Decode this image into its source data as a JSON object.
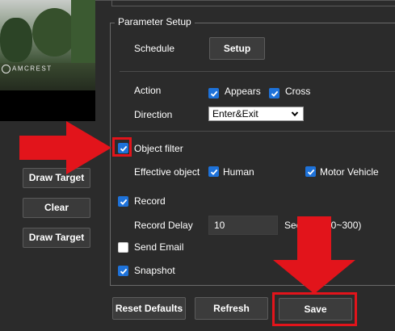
{
  "preview": {
    "logo_text": "AMCREST"
  },
  "left_buttons": [
    "Draw Target",
    "Clear",
    "Draw Target"
  ],
  "parameter_setup": {
    "legend": "Parameter Setup",
    "schedule": {
      "label": "Schedule",
      "button": "Setup"
    },
    "action": {
      "label": "Action",
      "appears": {
        "label": "Appears",
        "checked": true
      },
      "cross": {
        "label": "Cross",
        "checked": true
      }
    },
    "direction": {
      "label": "Direction",
      "value": "Enter&Exit"
    },
    "object_filter": {
      "label": "Object filter",
      "checked": true
    },
    "effective_object": {
      "label": "Effective object",
      "human": {
        "label": "Human",
        "checked": true
      },
      "motor_vehicle": {
        "label": "Motor Vehicle",
        "checked": true
      }
    },
    "record": {
      "label": "Record",
      "checked": true
    },
    "record_delay": {
      "label": "Record Delay",
      "value": "10",
      "unit_before": "Sec",
      "unit_after": "10~300)"
    },
    "send_email": {
      "label": "Send Email",
      "checked": false
    },
    "snapshot": {
      "label": "Snapshot",
      "checked": true
    }
  },
  "footer": {
    "reset": "Reset Defaults",
    "refresh": "Refresh",
    "save": "Save"
  },
  "colors": {
    "annotation_red": "#e2141b",
    "checkbox_blue": "#1e72d9"
  }
}
